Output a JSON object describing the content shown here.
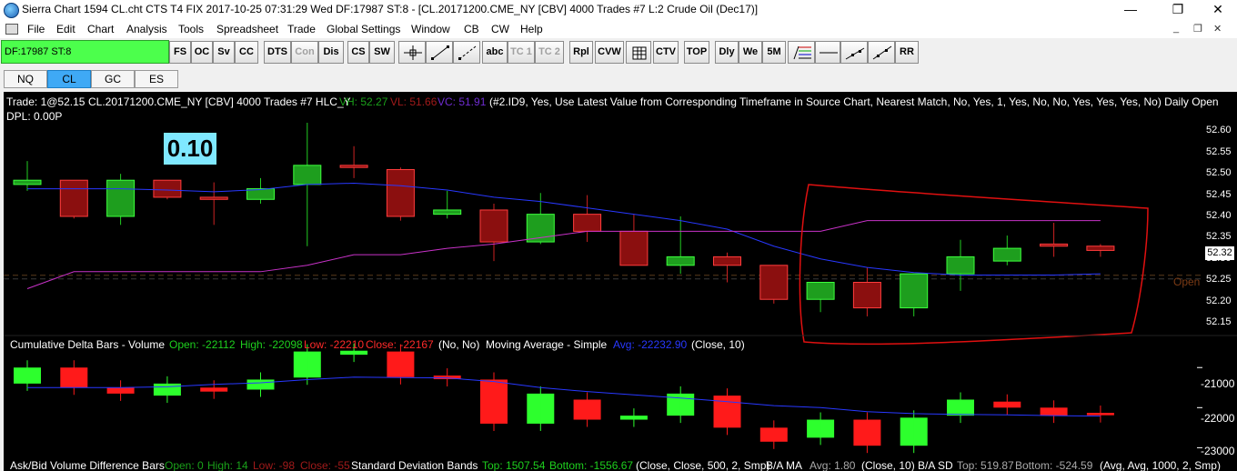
{
  "window": {
    "title": "Sierra Chart 1594 CL.cht  CTS T4 FIX 2017-10-25  07:31:29 Wed  DF:17987  ST:8 - [CL.20171200.CME_NY [CBV]  4000 Trades  #7  L:2  Crude Oil (Dec17)]",
    "controls": [
      "—",
      "❐",
      "✕"
    ],
    "mdi_controls": [
      "_",
      "❐",
      "✕"
    ]
  },
  "menu": [
    "File",
    "Edit",
    "Chart",
    "Analysis",
    "Tools",
    "Spreadsheet",
    "Trade",
    "Global Settings",
    "Window",
    "CB",
    "CW",
    "Help"
  ],
  "toolbar": {
    "status": "DF:17987  ST:8",
    "buttons": [
      "FS",
      "OC",
      "Sv",
      "CC",
      "DTS",
      "Con",
      "Dis",
      "CS",
      "SW",
      "",
      "",
      "",
      "abc",
      "TC 1",
      "TC 2",
      "Rpl",
      "CVW",
      "",
      "CTV",
      "TOP",
      "Dly",
      "We",
      "5M",
      "",
      "",
      "",
      "",
      "RR"
    ],
    "disabled": [
      "Con",
      "TC 1",
      "TC 2"
    ]
  },
  "tabs": [
    "NQ",
    "CL",
    "GC",
    "ES"
  ],
  "active_tab": "CL",
  "chart": {
    "header": {
      "trade": "Trade: 1@52.15",
      "symbol": "CL.20171200.CME_NY [CBV]  4000 Trades  #7 HLC_Y",
      "vh": "VH: 52.27",
      "vl": "VL: 51.66",
      "vc": "VC: 51.91",
      "study": "(#2.ID9, Yes, Use Latest Value from Corresponding Timeframe in Source Chart, Nearest Match, No, Yes, 1, Yes, No, No, Yes, Yes, Yes, No)  Daily Open",
      "dpl": "DPL: 0.00P"
    },
    "box_label": "0.10",
    "price_labels": [
      "52.60",
      "52.55",
      "52.50",
      "52.45",
      "52.40",
      "52.35",
      "52.30",
      "52.25",
      "52.20",
      "52.15"
    ],
    "current_price": "52.32",
    "open_label": "Open",
    "delta_header": {
      "name": "Cumulative Delta Bars - Volume",
      "open": "Open: -22112",
      "high": "High: -22098",
      "low": "Low: -22210",
      "close": "Close: -22167",
      "params": "(No, No)",
      "ma_name": "Moving Average - Simple",
      "ma_avg": "Avg: -22232.90",
      "ma_params": "(Close, 10)"
    },
    "delta_labels": [
      "-21000",
      "-22000",
      "-23000"
    ],
    "bottom_header": {
      "name": "Ask/Bid Volume Difference Bars",
      "open": "Open: 0",
      "high": "High: 14",
      "low": "Low: -98",
      "close": "Close: -55",
      "sd_name": "Standard Deviation Bands",
      "top": "Top: 1507.54",
      "bottom": "Bottom: -1556.67",
      "sd_params": "(Close, Close, 500, 2, Smp)",
      "ba_ma": "B/A MA",
      "ba_avg": "Avg: 1.80",
      "ba_params": "(Close, 10)",
      "ba_sd": "B/A SD",
      "ba_top": "Top: 519.87",
      "ba_bottom": "Bottom: -524.59",
      "ba_sd_params": "(Avg, Avg, 1000, 2, Smp)"
    }
  },
  "colors": {
    "up_fill": "#1e9e1e",
    "down_fill": "#8b0f0f",
    "ma_line": "#2838ff",
    "daily_open": "#c832c8",
    "annotation": "#e01010",
    "delta_up": "#2dff2d",
    "delta_down": "#ff1a1a",
    "box_bg": "#7fe8ff"
  },
  "chart_data": [
    {
      "type": "candlestick",
      "title": "CL.20171200.CME_NY [CBV]  4000 Trades  #7 HLC_Y",
      "ylim": [
        52.12,
        52.65
      ],
      "bars": [
        {
          "o": 52.475,
          "h": 52.53,
          "l": 52.46,
          "c": 52.485
        },
        {
          "o": 52.485,
          "h": 52.485,
          "l": 52.395,
          "c": 52.4
        },
        {
          "o": 52.4,
          "h": 52.5,
          "l": 52.38,
          "c": 52.485
        },
        {
          "o": 52.485,
          "h": 52.485,
          "l": 52.44,
          "c": 52.445
        },
        {
          "o": 52.445,
          "h": 52.48,
          "l": 52.38,
          "c": 52.44
        },
        {
          "o": 52.44,
          "h": 52.49,
          "l": 52.43,
          "c": 52.465
        },
        {
          "o": 52.475,
          "h": 52.62,
          "l": 52.33,
          "c": 52.52
        },
        {
          "o": 52.52,
          "h": 52.565,
          "l": 52.49,
          "c": 52.515
        },
        {
          "o": 52.51,
          "h": 52.515,
          "l": 52.39,
          "c": 52.4
        },
        {
          "o": 52.405,
          "h": 52.46,
          "l": 52.395,
          "c": 52.415
        },
        {
          "o": 52.415,
          "h": 52.43,
          "l": 52.295,
          "c": 52.34
        },
        {
          "o": 52.34,
          "h": 52.455,
          "l": 52.335,
          "c": 52.405
        },
        {
          "o": 52.405,
          "h": 52.45,
          "l": 52.34,
          "c": 52.365
        },
        {
          "o": 52.365,
          "h": 52.405,
          "l": 52.285,
          "c": 52.285
        },
        {
          "o": 52.285,
          "h": 52.4,
          "l": 52.265,
          "c": 52.305
        },
        {
          "o": 52.305,
          "h": 52.315,
          "l": 52.245,
          "c": 52.285
        },
        {
          "o": 52.285,
          "h": 52.285,
          "l": 52.195,
          "c": 52.205
        },
        {
          "o": 52.205,
          "h": 52.245,
          "l": 52.175,
          "c": 52.245
        },
        {
          "o": 52.245,
          "h": 52.28,
          "l": 52.165,
          "c": 52.185
        },
        {
          "o": 52.185,
          "h": 52.265,
          "l": 52.165,
          "c": 52.265
        },
        {
          "o": 52.265,
          "h": 52.345,
          "l": 52.225,
          "c": 52.305
        },
        {
          "o": 52.295,
          "h": 52.355,
          "l": 52.285,
          "c": 52.325
        },
        {
          "o": 52.335,
          "h": 52.385,
          "l": 52.305,
          "c": 52.33
        },
        {
          "o": 52.33,
          "h": 52.335,
          "l": 52.305,
          "c": 52.32
        }
      ],
      "ma": [
        52.465,
        52.465,
        52.465,
        52.462,
        52.458,
        52.463,
        52.475,
        52.478,
        52.472,
        52.462,
        52.445,
        52.435,
        52.42,
        52.405,
        52.39,
        52.37,
        52.33,
        52.3,
        52.28,
        52.268,
        52.262,
        52.262,
        52.262,
        52.265
      ],
      "daily_open": [
        52.23,
        52.27,
        52.27,
        52.27,
        52.27,
        52.27,
        52.285,
        52.31,
        52.31,
        52.325,
        52.335,
        52.35,
        52.365,
        52.365,
        52.365,
        52.365,
        52.365,
        52.365,
        52.39,
        52.39,
        52.39,
        52.39,
        52.39,
        52.39
      ]
    },
    {
      "type": "bar",
      "title": "Cumulative Delta Bars - Volume",
      "ylim": [
        -23150,
        -20700
      ],
      "bars": [
        {
          "o": -21000,
          "c": -21400,
          "up": true
        },
        {
          "o": -21000,
          "c": -21500,
          "up": false
        },
        {
          "o": -21500,
          "c": -21650,
          "up": false
        },
        {
          "o": -21400,
          "c": -21700,
          "up": true
        },
        {
          "o": -21500,
          "c": -21600,
          "up": false
        },
        {
          "o": -21300,
          "c": -21550,
          "up": true
        },
        {
          "o": -20600,
          "c": -21250,
          "up": true
        },
        {
          "o": -20580,
          "c": -20680,
          "up": true
        },
        {
          "o": -20600,
          "c": -21240,
          "up": false
        },
        {
          "o": -21200,
          "c": -21290,
          "up": false
        },
        {
          "o": -21300,
          "c": -22400,
          "up": false
        },
        {
          "o": -21650,
          "c": -22400,
          "up": true
        },
        {
          "o": -21800,
          "c": -22300,
          "up": false
        },
        {
          "o": -22200,
          "c": -22300,
          "up": true
        },
        {
          "o": -21650,
          "c": -22200,
          "up": true
        },
        {
          "o": -21700,
          "c": -22500,
          "up": false
        },
        {
          "o": -22500,
          "c": -22850,
          "up": false
        },
        {
          "o": -22300,
          "c": -22750,
          "up": true
        },
        {
          "o": -22300,
          "c": -22950,
          "up": false
        },
        {
          "o": -22250,
          "c": -22950,
          "up": true
        },
        {
          "o": -21800,
          "c": -22200,
          "up": true
        },
        {
          "o": -21850,
          "c": -22000,
          "up": false
        },
        {
          "o": -22000,
          "c": -22200,
          "up": false
        },
        {
          "o": -22130,
          "c": -22190,
          "up": false
        }
      ],
      "ma": [
        -21500,
        -21500,
        -21500,
        -21480,
        -21420,
        -21380,
        -21300,
        -21240,
        -21250,
        -21260,
        -21350,
        -21500,
        -21600,
        -21680,
        -21760,
        -21850,
        -21950,
        -22000,
        -22100,
        -22150,
        -22170,
        -22180,
        -22200,
        -22210
      ]
    }
  ]
}
